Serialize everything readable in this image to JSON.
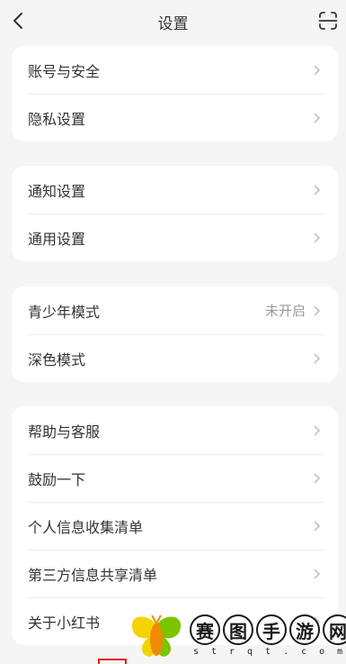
{
  "header": {
    "title": "设置"
  },
  "groups": [
    {
      "items": [
        {
          "label": "账号与安全"
        },
        {
          "label": "隐私设置"
        }
      ]
    },
    {
      "items": [
        {
          "label": "通知设置"
        },
        {
          "label": "通用设置"
        }
      ]
    },
    {
      "items": [
        {
          "label": "青少年模式",
          "value": "未开启"
        },
        {
          "label": "深色模式"
        }
      ]
    },
    {
      "items": [
        {
          "label": "帮助与客服"
        },
        {
          "label": "鼓励一下"
        },
        {
          "label": "个人信息收集清单"
        },
        {
          "label": "第三方信息共享清单"
        },
        {
          "label": "关于小红书"
        }
      ]
    }
  ],
  "watermark": {
    "chars": [
      "赛",
      "图",
      "手",
      "游",
      "网"
    ],
    "domain": "strqt.com"
  },
  "colors": {
    "background": "#f5f5f5",
    "card": "#ffffff",
    "text": "#333333",
    "secondary_text": "#9a9a9a",
    "watermark_yellow": "#f5d300",
    "watermark_orange": "#f08a00",
    "watermark_green": "#7cc400"
  },
  "icons": {
    "back": "chevron-left-icon",
    "scan": "scan-icon",
    "row_arrow": "chevron-right-icon"
  }
}
